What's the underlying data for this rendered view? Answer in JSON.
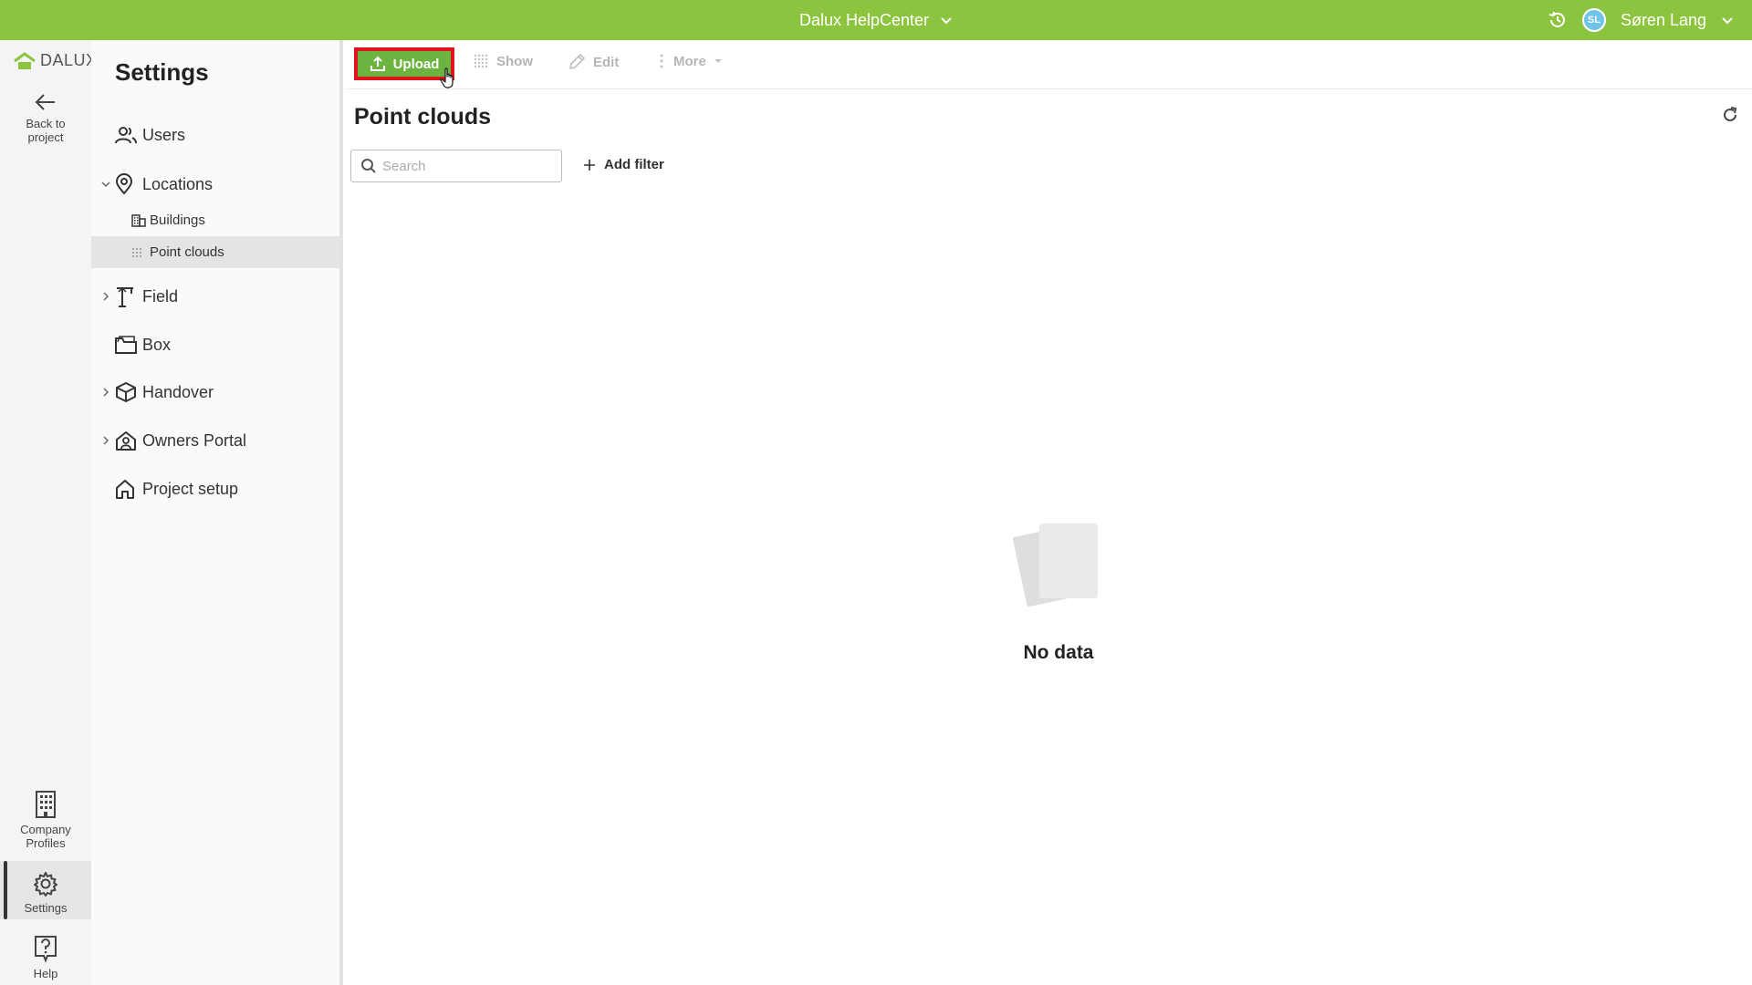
{
  "topbar": {
    "project_title": "Dalux HelpCenter",
    "user_initials": "SL",
    "user_name": "Søren Lang",
    "accent": "#8cc43f"
  },
  "rail": {
    "logo_text": "DALUX",
    "back_label": "Back to project",
    "company_profiles_label": "Company Profiles",
    "settings_label": "Settings",
    "help_label": "Help"
  },
  "settings": {
    "title": "Settings",
    "items": [
      {
        "label": "Users",
        "icon": "users-icon"
      },
      {
        "label": "Locations",
        "icon": "location-pin-icon",
        "expanded": true
      },
      {
        "label": "Field",
        "icon": "field-crane-icon"
      },
      {
        "label": "Box",
        "icon": "box-folder-icon"
      },
      {
        "label": "Handover",
        "icon": "handover-cube-icon"
      },
      {
        "label": "Owners Portal",
        "icon": "owners-portal-icon"
      },
      {
        "label": "Project setup",
        "icon": "home-icon"
      }
    ],
    "location_children": [
      {
        "label": "Buildings",
        "icon": "buildings-icon"
      },
      {
        "label": "Point clouds",
        "icon": "point-cloud-icon",
        "selected": true
      }
    ]
  },
  "toolbar": {
    "upload_label": "Upload",
    "show_label": "Show",
    "edit_label": "Edit",
    "more_label": "More",
    "highlight_color": "#e0141e",
    "upload_color": "#6cb33f"
  },
  "main": {
    "title": "Point clouds",
    "search_placeholder": "Search",
    "search_value": "",
    "add_filter_label": "Add filter",
    "empty_label": "No data"
  }
}
